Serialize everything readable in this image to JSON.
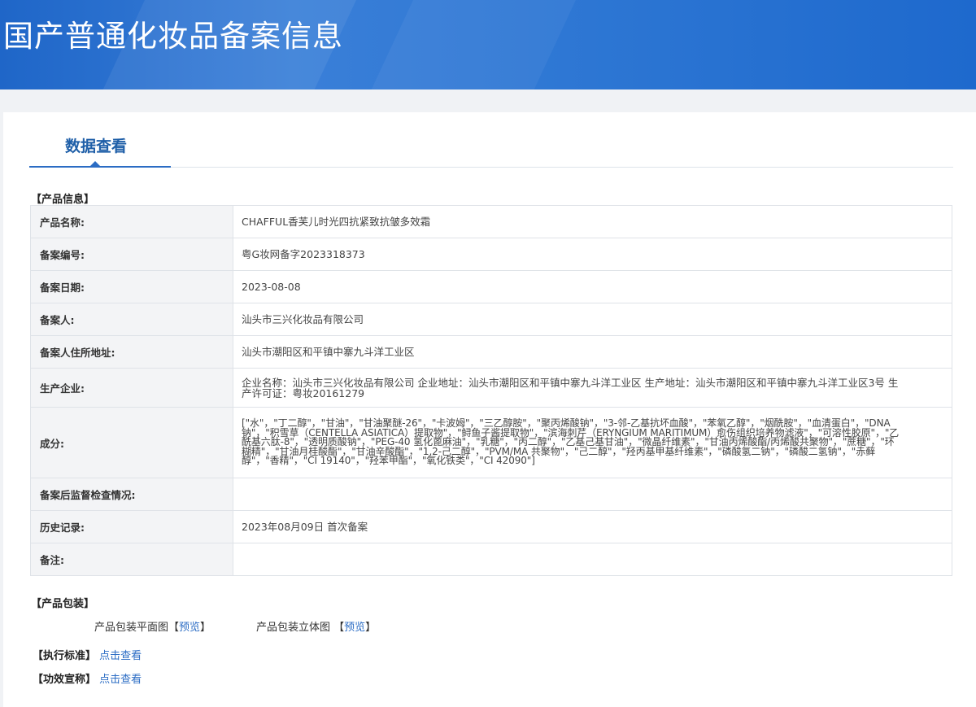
{
  "header": {
    "title": "国产普通化妆品备案信息"
  },
  "tab": {
    "label": "数据查看"
  },
  "product_info": {
    "section_label": "【产品信息】",
    "rows": [
      {
        "label": "产品名称:",
        "value": "CHAFFUL香芙儿时光四抗紧致抗皱多效霜"
      },
      {
        "label": "备案编号:",
        "value": "粤G妆网备字2023318373"
      },
      {
        "label": "备案日期:",
        "value": "2023-08-08"
      },
      {
        "label": "备案人:",
        "value": "汕头市三兴化妆品有限公司"
      },
      {
        "label": "备案人住所地址:",
        "value": "汕头市潮阳区和平镇中寨九斗洋工业区"
      },
      {
        "label": "生产企业:",
        "value": "企业名称：汕头市三兴化妆品有限公司 企业地址：汕头市潮阳区和平镇中寨九斗洋工业区 生产地址：汕头市潮阳区和平镇中寨九斗洋工业区3号 生产许可证：粤妆20161279"
      },
      {
        "label": "成分:",
        "value": "[\"水\"，\"丁二醇\"，\"甘油\"，\"甘油聚醚-26\"，\"卡波姆\"，\"三乙醇胺\"，\"聚丙烯酸钠\"，\"3-邻-乙基抗坏血酸\"，\"苯氧乙醇\"，\"烟酰胺\"，\"血清蛋白\"，\"DNA 钠\"，\"积雪草（CENTELLA ASIATICA）提取物\"，\"鲟鱼子酱提取物\"，\"滨海刺芹（ERYNGIUM MARITIMUM）愈伤组织培养物滤液\"，\"可溶性胶原\"，\"乙酰基六肽-8\"，\"透明质酸钠\"，\"PEG-40 氢化蓖麻油\"，\"乳糖\"，\"丙二醇\"，\"乙基己基甘油\"，\"微晶纤维素\"，\"甘油丙烯酸酯/丙烯酸共聚物\"，\"蔗糖\"，\"环糊精\"，\"甘油月桂酸酯\"，\"甘油辛酸酯\"，\"1,2-己二醇\"，\"PVM/MA 共聚物\"，\"己二醇\"，\"羟丙基甲基纤维素\"，\"磷酸氢二钠\"，\"磷酸二氢钠\"，\"赤藓醇\"，\"香精\"，\"CI 19140\"，\"羟苯甲酯\"，\"氧化铁类\"，\"CI 42090\"]"
      },
      {
        "label": "备案后监督检查情况:",
        "value": ""
      },
      {
        "label": "历史记录:",
        "value": "2023年08月09日 首次备案"
      },
      {
        "label": "备注:",
        "value": ""
      }
    ]
  },
  "packaging": {
    "section_label": "【产品包装】",
    "flat_label": "产品包装平面图【",
    "flat_link": "预览",
    "flat_close": "】",
    "solid_label": "产品包装立体图 【",
    "solid_link": "预览",
    "solid_close": "】"
  },
  "standard": {
    "label": "【执行标准】",
    "link": "点击查看"
  },
  "efficacy": {
    "label": "【功效宣称】",
    "link": "点击查看"
  }
}
